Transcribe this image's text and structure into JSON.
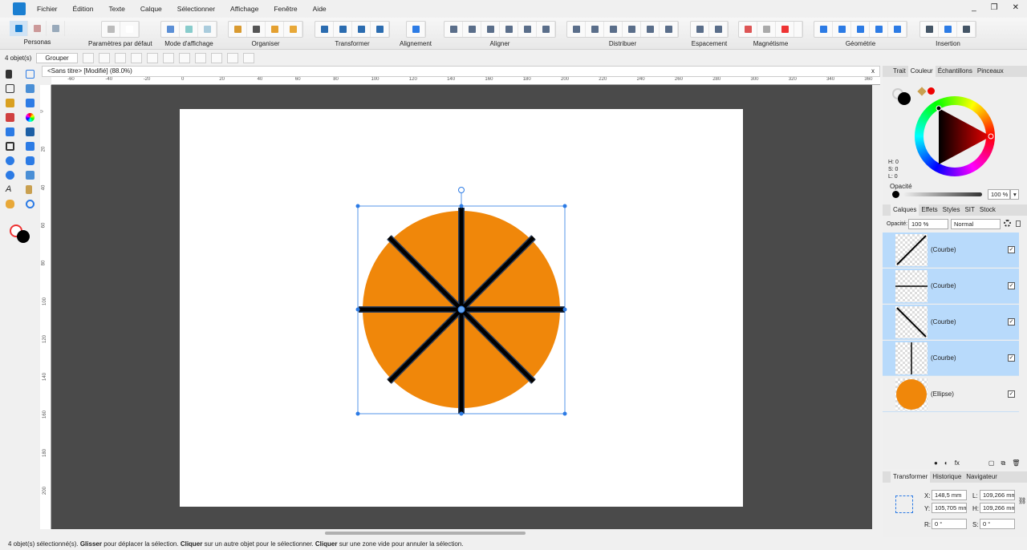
{
  "menu": [
    "Fichier",
    "Édition",
    "Texte",
    "Calque",
    "Sélectionner",
    "Affichage",
    "Fenêtre",
    "Aide"
  ],
  "window_controls": [
    "_",
    "❐",
    "✕"
  ],
  "toolbar": {
    "personas": "Personas",
    "defaults": "Paramètres par défaut",
    "view_mode": "Mode d'affichage",
    "arrange": "Organiser",
    "transform": "Transformer",
    "alignment": "Alignement",
    "align": "Aligner",
    "distribute": "Distribuer",
    "spacing": "Espacement",
    "snapping": "Magnétisme",
    "geometry": "Géométrie",
    "insert": "Insertion"
  },
  "context": {
    "count": "4 objet(s)",
    "group": "Grouper"
  },
  "document": {
    "title": "<Sans titre> [Modifié] (88.0%)",
    "close": "x"
  },
  "rulers": {
    "top": [
      "-60",
      "-40",
      "-20",
      "0",
      "20",
      "40",
      "60",
      "80",
      "100",
      "120",
      "140",
      "160",
      "180",
      "200",
      "220",
      "240",
      "260",
      "280",
      "300",
      "320",
      "340",
      "360"
    ],
    "left": [
      "0",
      "20",
      "40",
      "60",
      "80",
      "100",
      "120",
      "140",
      "160",
      "180",
      "200"
    ]
  },
  "colors": {
    "circle": "#f0870a",
    "accent": "#2c7be5",
    "selected_layer": "#b8dafb"
  },
  "color_panel": {
    "tabs": [
      "Trait",
      "Couleur",
      "Échantillons",
      "Pinceaux"
    ],
    "h": "H: 0",
    "s": "S: 0",
    "l": "L: 0",
    "opacity_label": "Opacité",
    "opacity": "100 %"
  },
  "layers_panel": {
    "tabs": [
      "Calques",
      "Effets",
      "Styles",
      "SIT",
      "Stock"
    ],
    "opacity_label": "Opacité:",
    "opacity": "100 %",
    "blend": "Normal",
    "layers": [
      {
        "name": "(Courbe)",
        "selected": true
      },
      {
        "name": "(Courbe)",
        "selected": true
      },
      {
        "name": "(Courbe)",
        "selected": true
      },
      {
        "name": "(Courbe)",
        "selected": true
      },
      {
        "name": "(Ellipse)",
        "selected": false
      }
    ]
  },
  "transform_panel": {
    "tabs": [
      "Transformer",
      "Historique",
      "Navigateur"
    ],
    "x_label": "X:",
    "x": "148,5 mm",
    "y_label": "Y:",
    "y": "105,705 mm",
    "w_label": "L:",
    "w": "109,266 mm",
    "h_label": "H:",
    "h": "109,266 mm",
    "r_label": "R:",
    "r": "0 °",
    "s_label": "S:",
    "s": "0 °"
  },
  "status": {
    "pre": "4 objet(s) sélectionné(s). ",
    "b1": "Glisser",
    "t1": " pour déplacer la sélection. ",
    "b2": "Cliquer",
    "t2": " sur un autre objet pour le sélectionner. ",
    "b3": "Cliquer",
    "t3": " sur une zone vide pour annuler la sélection."
  }
}
